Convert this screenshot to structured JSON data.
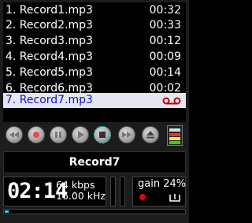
{
  "playlist": [
    {
      "name": "1. Record1.mp3",
      "duration": "00:32",
      "selected": false
    },
    {
      "name": "2. Record2.mp3",
      "duration": "00:33",
      "selected": false
    },
    {
      "name": "3. Record3.mp3",
      "duration": "00:12",
      "selected": false
    },
    {
      "name": "4. Record4.mp3",
      "duration": "00:09",
      "selected": false
    },
    {
      "name": "5. Record5.mp3",
      "duration": "00:14",
      "selected": false
    },
    {
      "name": "6. Record6.mp3",
      "duration": "00:02",
      "selected": false
    },
    {
      "name": "7. Record7.mp3",
      "duration": "",
      "selected": true
    }
  ],
  "controls": [
    "rewind-icon",
    "record-icon",
    "pause-icon",
    "play-icon",
    "stop-icon",
    "fast-forward-icon",
    "eject-icon",
    "equalizer-icon"
  ],
  "now_playing": {
    "title": "Record7"
  },
  "status": {
    "time": "02:14",
    "bitrate": "64 kbps",
    "samplerate": "16.00 kHz",
    "gain": "gain 24%"
  },
  "progress": 0.02,
  "colors": {
    "accent": "#2ad0ff",
    "selected_text": "#1212c8",
    "record_red": "#e00000"
  }
}
